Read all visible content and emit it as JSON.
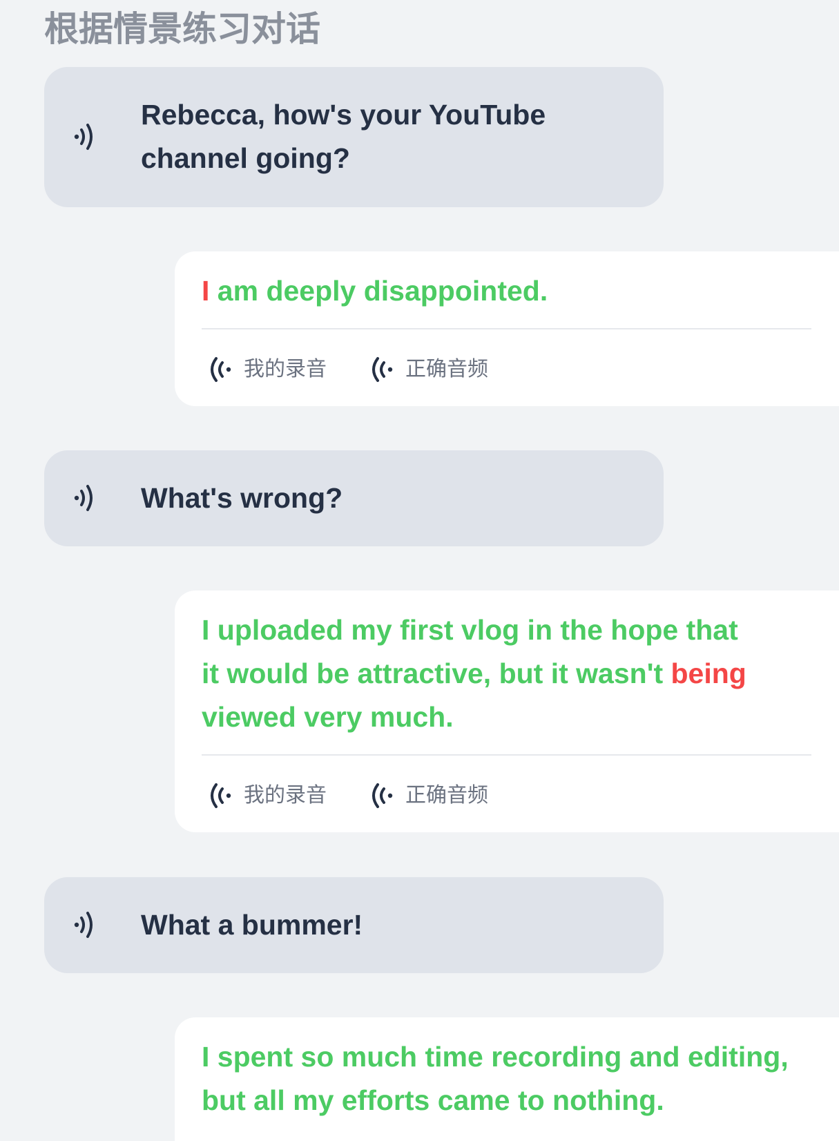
{
  "page": {
    "title": "根据情景练习对话"
  },
  "colors": {
    "background": "#f1f3f5",
    "prompt_bubble": "#dfe3ea",
    "answer_bubble": "#ffffff",
    "prompt_text": "#253044",
    "correct_text": "#4ccb63",
    "error_text": "#f44646",
    "muted": "#6b7280"
  },
  "icons": {
    "prompt_play": "speaker-wave-icon",
    "audio_button": "broadcast-wave-icon"
  },
  "dialogue": [
    {
      "role": "prompt",
      "lines": [
        "Rebecca, how's your YouTube",
        "channel going?"
      ]
    },
    {
      "role": "answer",
      "lines": [
        [
          {
            "t": "I",
            "s": "error"
          },
          {
            "t": " am deeply disappointed.",
            "s": "correct"
          }
        ]
      ],
      "buttons": [
        "我的录音",
        "正确音频"
      ]
    },
    {
      "role": "prompt",
      "lines": [
        "What's wrong?"
      ]
    },
    {
      "role": "answer",
      "lines": [
        [
          {
            "t": "I uploaded my first vlog in the hope that",
            "s": "correct"
          }
        ],
        [
          {
            "t": "it would be attractive, but it wasn't ",
            "s": "correct"
          },
          {
            "t": "being",
            "s": "error"
          }
        ],
        [
          {
            "t": "viewed very much.",
            "s": "correct"
          }
        ]
      ],
      "buttons": [
        "我的录音",
        "正确音频"
      ]
    },
    {
      "role": "prompt",
      "lines": [
        "What a bummer!"
      ]
    },
    {
      "role": "answer",
      "lines": [
        [
          {
            "t": "I spent so much time recording and editing,",
            "s": "correct"
          }
        ],
        [
          {
            "t": "but all my efforts came to nothing.",
            "s": "correct"
          }
        ]
      ]
    }
  ]
}
